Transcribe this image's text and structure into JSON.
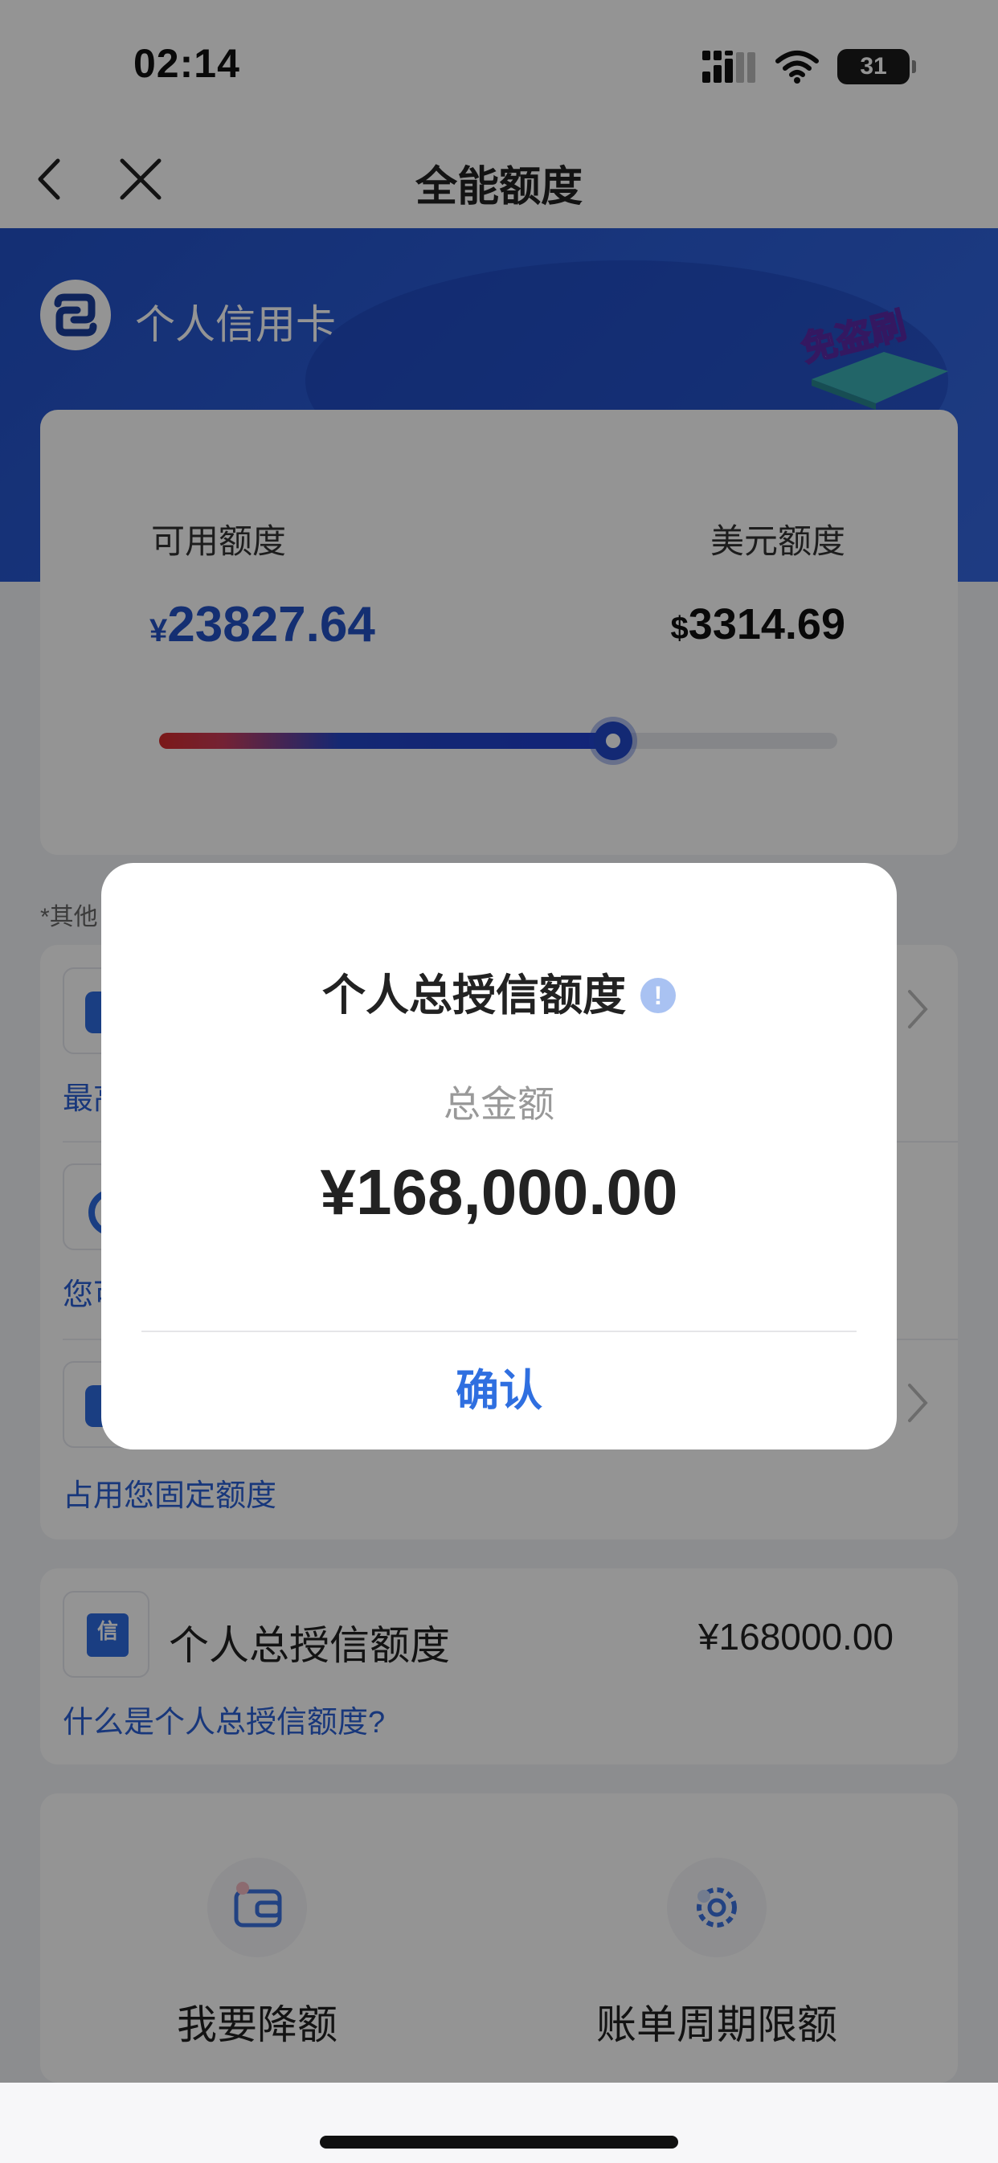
{
  "status_bar": {
    "time": "02:14",
    "battery": "31"
  },
  "nav": {
    "title": "全能额度"
  },
  "hero": {
    "title": "个人信用卡",
    "badge_text": "免盗刷"
  },
  "quota": {
    "available_label": "可用额度",
    "available_currency": "¥",
    "available_value": "23827.64",
    "usd_label": "美元额度",
    "usd_currency": "$",
    "usd_value": "3314.69",
    "usage_fraction": 0.67
  },
  "footnote": "*其他",
  "rows": [
    {
      "sub": "最高"
    },
    {
      "sub": "您可"
    },
    {
      "sub": "占用您固定额度"
    }
  ],
  "credit": {
    "icon_char": "信",
    "title": "个人总授信额度",
    "amount": "¥168000.00",
    "link": "什么是个人总授信额度?"
  },
  "actions": [
    {
      "label": "我要降额",
      "icon": "wallet-icon"
    },
    {
      "label": "账单周期限额",
      "icon": "gear-icon"
    }
  ],
  "modal": {
    "title": "个人总授信额度",
    "info_glyph": "!",
    "amount_label": "总金额",
    "amount": "¥168,000.00",
    "confirm": "确认"
  },
  "colors": {
    "accent": "#2f6fe0",
    "hero_blue": "#2b5ed8",
    "link_blue": "#2a5fd4",
    "slider_red": "#d42b2b"
  }
}
